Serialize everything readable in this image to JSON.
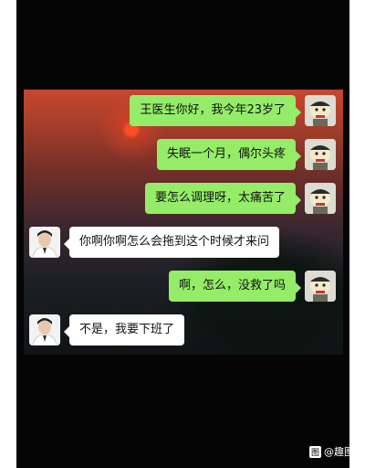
{
  "messages": [
    {
      "side": "right",
      "avatar": "patient-cartoon-avatar",
      "text": "王医生你好，我今年23岁了"
    },
    {
      "side": "right",
      "avatar": "patient-cartoon-avatar",
      "text": "失眠一个月，偶尔头疼"
    },
    {
      "side": "right",
      "avatar": "patient-cartoon-avatar",
      "text": "要怎么调理呀，太痛苦了"
    },
    {
      "side": "left",
      "avatar": "doctor-avatar",
      "text": "你啊你啊怎么会拖到这个时候才来问"
    },
    {
      "side": "right",
      "avatar": "patient-cartoon-avatar",
      "text": "啊，怎么，没救了吗"
    },
    {
      "side": "left",
      "avatar": "doctor-avatar",
      "text": "不是，我要下班了"
    }
  ],
  "colors": {
    "sent_bubble": "#95ec69",
    "received_bubble": "#ffffff",
    "frame": "#050505"
  },
  "watermark": {
    "logo_text": "图",
    "text": "@趣图"
  }
}
